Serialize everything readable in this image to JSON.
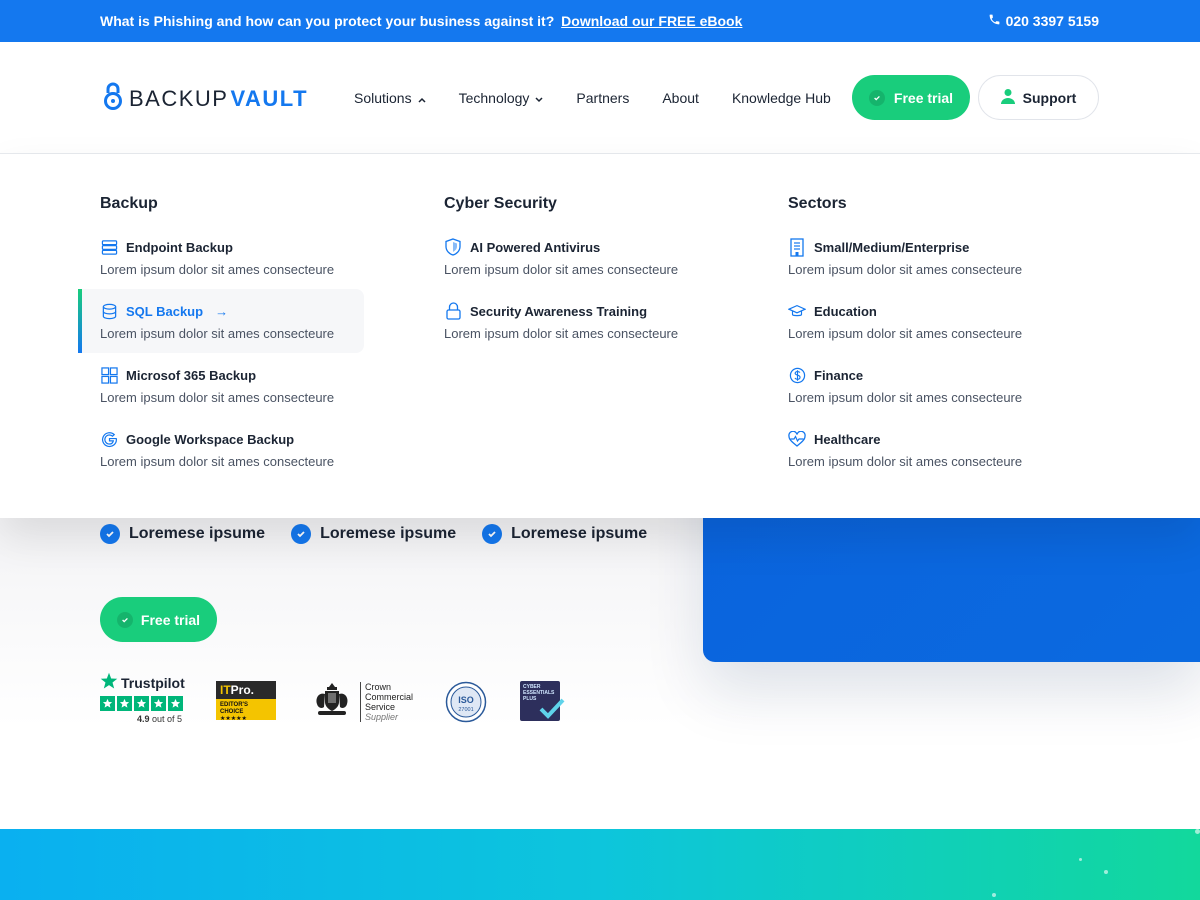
{
  "topbar": {
    "message": "What is Phishing and how can you protect your business against it?",
    "link": "Download our FREE eBook",
    "phone": "020 3397 5159"
  },
  "brand": {
    "part1": "BACKUP",
    "part2": "VAULT"
  },
  "nav": {
    "items": [
      {
        "label": "Solutions",
        "chevron": "up"
      },
      {
        "label": "Technology",
        "chevron": "down"
      },
      {
        "label": "Partners"
      },
      {
        "label": "About"
      },
      {
        "label": "Knowledge Hub"
      }
    ],
    "trial_label": "Free trial",
    "support_label": "Support"
  },
  "mega_menu": {
    "columns": [
      {
        "title": "Backup",
        "items": [
          {
            "title": "Endpoint Backup",
            "desc": "Lorem ipsum dolor sit ames consecteure",
            "icon": "server-icon"
          },
          {
            "title": "SQL Backup",
            "desc": "Lorem ipsum dolor sit ames consecteure",
            "icon": "database-icon",
            "active": true,
            "arrow": "→"
          },
          {
            "title": "Microsof 365 Backup",
            "desc": "Lorem ipsum dolor sit ames consecteure",
            "icon": "grid-icon"
          },
          {
            "title": "Google Workspace Backup",
            "desc": "Lorem ipsum dolor sit ames consecteure",
            "icon": "google-icon"
          }
        ]
      },
      {
        "title": "Cyber Security",
        "items": [
          {
            "title": "AI Powered Antivirus",
            "desc": "Lorem ipsum dolor sit ames consecteure",
            "icon": "shield-icon"
          },
          {
            "title": "Security Awareness Training",
            "desc": "Lorem ipsum dolor sit ames consecteure",
            "icon": "lock-icon"
          }
        ]
      },
      {
        "title": "Sectors",
        "items": [
          {
            "title": "Small/Medium/Enterprise",
            "desc": "Lorem ipsum dolor sit ames consecteure",
            "icon": "building-icon"
          },
          {
            "title": "Education",
            "desc": "Lorem ipsum dolor sit ames consecteure",
            "icon": "graduation-cap-icon"
          },
          {
            "title": "Finance",
            "desc": "Lorem ipsum dolor sit ames consecteure",
            "icon": "dollar-icon"
          },
          {
            "title": "Healthcare",
            "desc": "Lorem ipsum dolor sit ames consecteure",
            "icon": "heart-pulse-icon"
          }
        ]
      }
    ]
  },
  "hero": {
    "bullets": [
      "Loremese ipsume",
      "Loremese ipsume",
      "Loremese ipsume"
    ],
    "trial_label": "Free trial"
  },
  "badges": {
    "trustpilot": {
      "name": "Trustpilot",
      "rating": "4.9",
      "rating_suffix": "out of 5"
    },
    "itpro": {
      "logo_a": "IT",
      "logo_b": "Pro.",
      "caption": "EDITOR'S CHOICE",
      "stars": "★★★★★"
    },
    "ccs": {
      "line1": "Crown",
      "line2": "Commercial",
      "line3": "Service",
      "line4": "Supplier"
    },
    "iso": {
      "label": "ISO",
      "number": "27001"
    },
    "cyber_essentials": {
      "line1": "CYBER",
      "line2": "ESSENTIALS",
      "line3": "PLUS"
    }
  },
  "colors": {
    "primary": "#1478ef",
    "green": "#19cd7c",
    "text": "#1b2433"
  }
}
